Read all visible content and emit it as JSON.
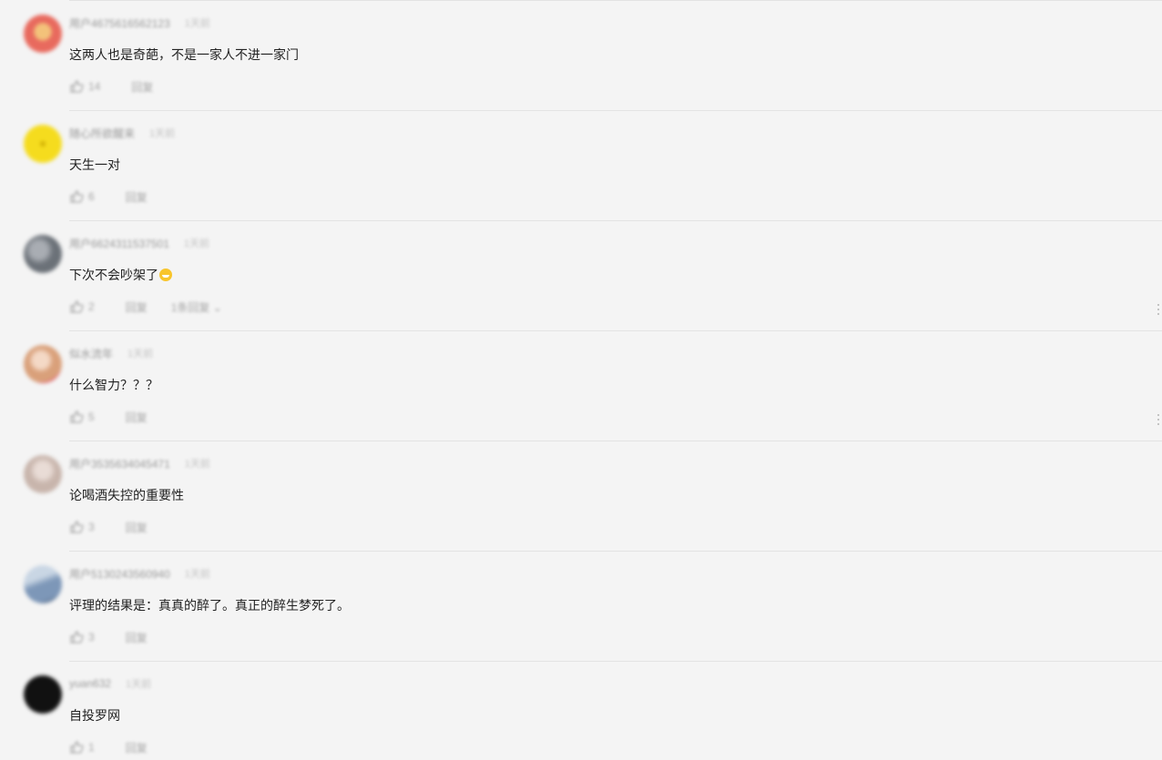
{
  "comments": [
    {
      "username": "用户4675616562123",
      "time": "1天前",
      "text": "这两人也是奇葩，不是一家人不进一家门",
      "likes": "14",
      "reply_label": "回复",
      "avatar_color": "#e86a5e"
    },
    {
      "username": "随心所欲醒来",
      "time": "1天前",
      "text": "天生一对",
      "likes": "6",
      "reply_label": "回复",
      "avatar_color": "#f5dc1e"
    },
    {
      "username": "用户6624311537501",
      "time": "1天前",
      "text": "下次不会吵架了",
      "emoji": "grin-emoji",
      "likes": "2",
      "reply_label": "回复",
      "expand_label": "1条回复",
      "avatar_color": "#6b7178",
      "has_more_menu": true
    },
    {
      "username": "似水流年",
      "time": "1天前",
      "text": "什么智力？？？",
      "likes": "5",
      "reply_label": "回复",
      "avatar_color": "#d9a07a",
      "has_more_menu": true
    },
    {
      "username": "用户3535634045471",
      "time": "1天前",
      "text": "论喝酒失控的重要性",
      "likes": "3",
      "reply_label": "回复",
      "avatar_color": "#c8b5ac"
    },
    {
      "username": "用户5130243560940",
      "time": "1天前",
      "text": "评理的结果是：真真的醉了。真正的醉生梦死了。",
      "likes": "3",
      "reply_label": "回复",
      "avatar_color": "#7d97b8"
    },
    {
      "username": "yuan632",
      "time": "1天前",
      "text": "自投罗网",
      "likes": "1",
      "reply_label": "回复",
      "avatar_color": "#111111"
    }
  ]
}
